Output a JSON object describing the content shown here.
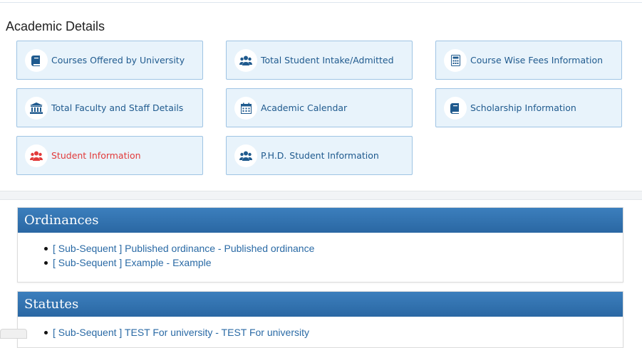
{
  "section_title": "Academic Details",
  "cards": [
    {
      "label": "Courses Offered by University",
      "icon": "book-icon"
    },
    {
      "label": "Total Student Intake/Admitted",
      "icon": "users-icon"
    },
    {
      "label": "Course Wise Fees Information",
      "icon": "calculator-icon"
    },
    {
      "label": "Total Faculty and Staff Details",
      "icon": "institution-icon"
    },
    {
      "label": "Academic Calendar",
      "icon": "calendar-icon"
    },
    {
      "label": "Scholarship Information",
      "icon": "book-icon"
    },
    {
      "label": "Student Information",
      "icon": "users-icon",
      "active": true
    },
    {
      "label": "P.H.D. Student Information",
      "icon": "users-icon"
    }
  ],
  "colors": {
    "card_text": "#1f5a8e",
    "active_text": "#e23a3a",
    "panel_header": "#2f6fad"
  },
  "ordinances": {
    "title": "Ordinances",
    "items": [
      "[ Sub-Sequent ] Published ordinance - Published ordinance",
      "[ Sub-Sequent ] Example - Example"
    ]
  },
  "statutes": {
    "title": "Statutes",
    "items": [
      "[ Sub-Sequent ] TEST For university - TEST For university"
    ]
  }
}
